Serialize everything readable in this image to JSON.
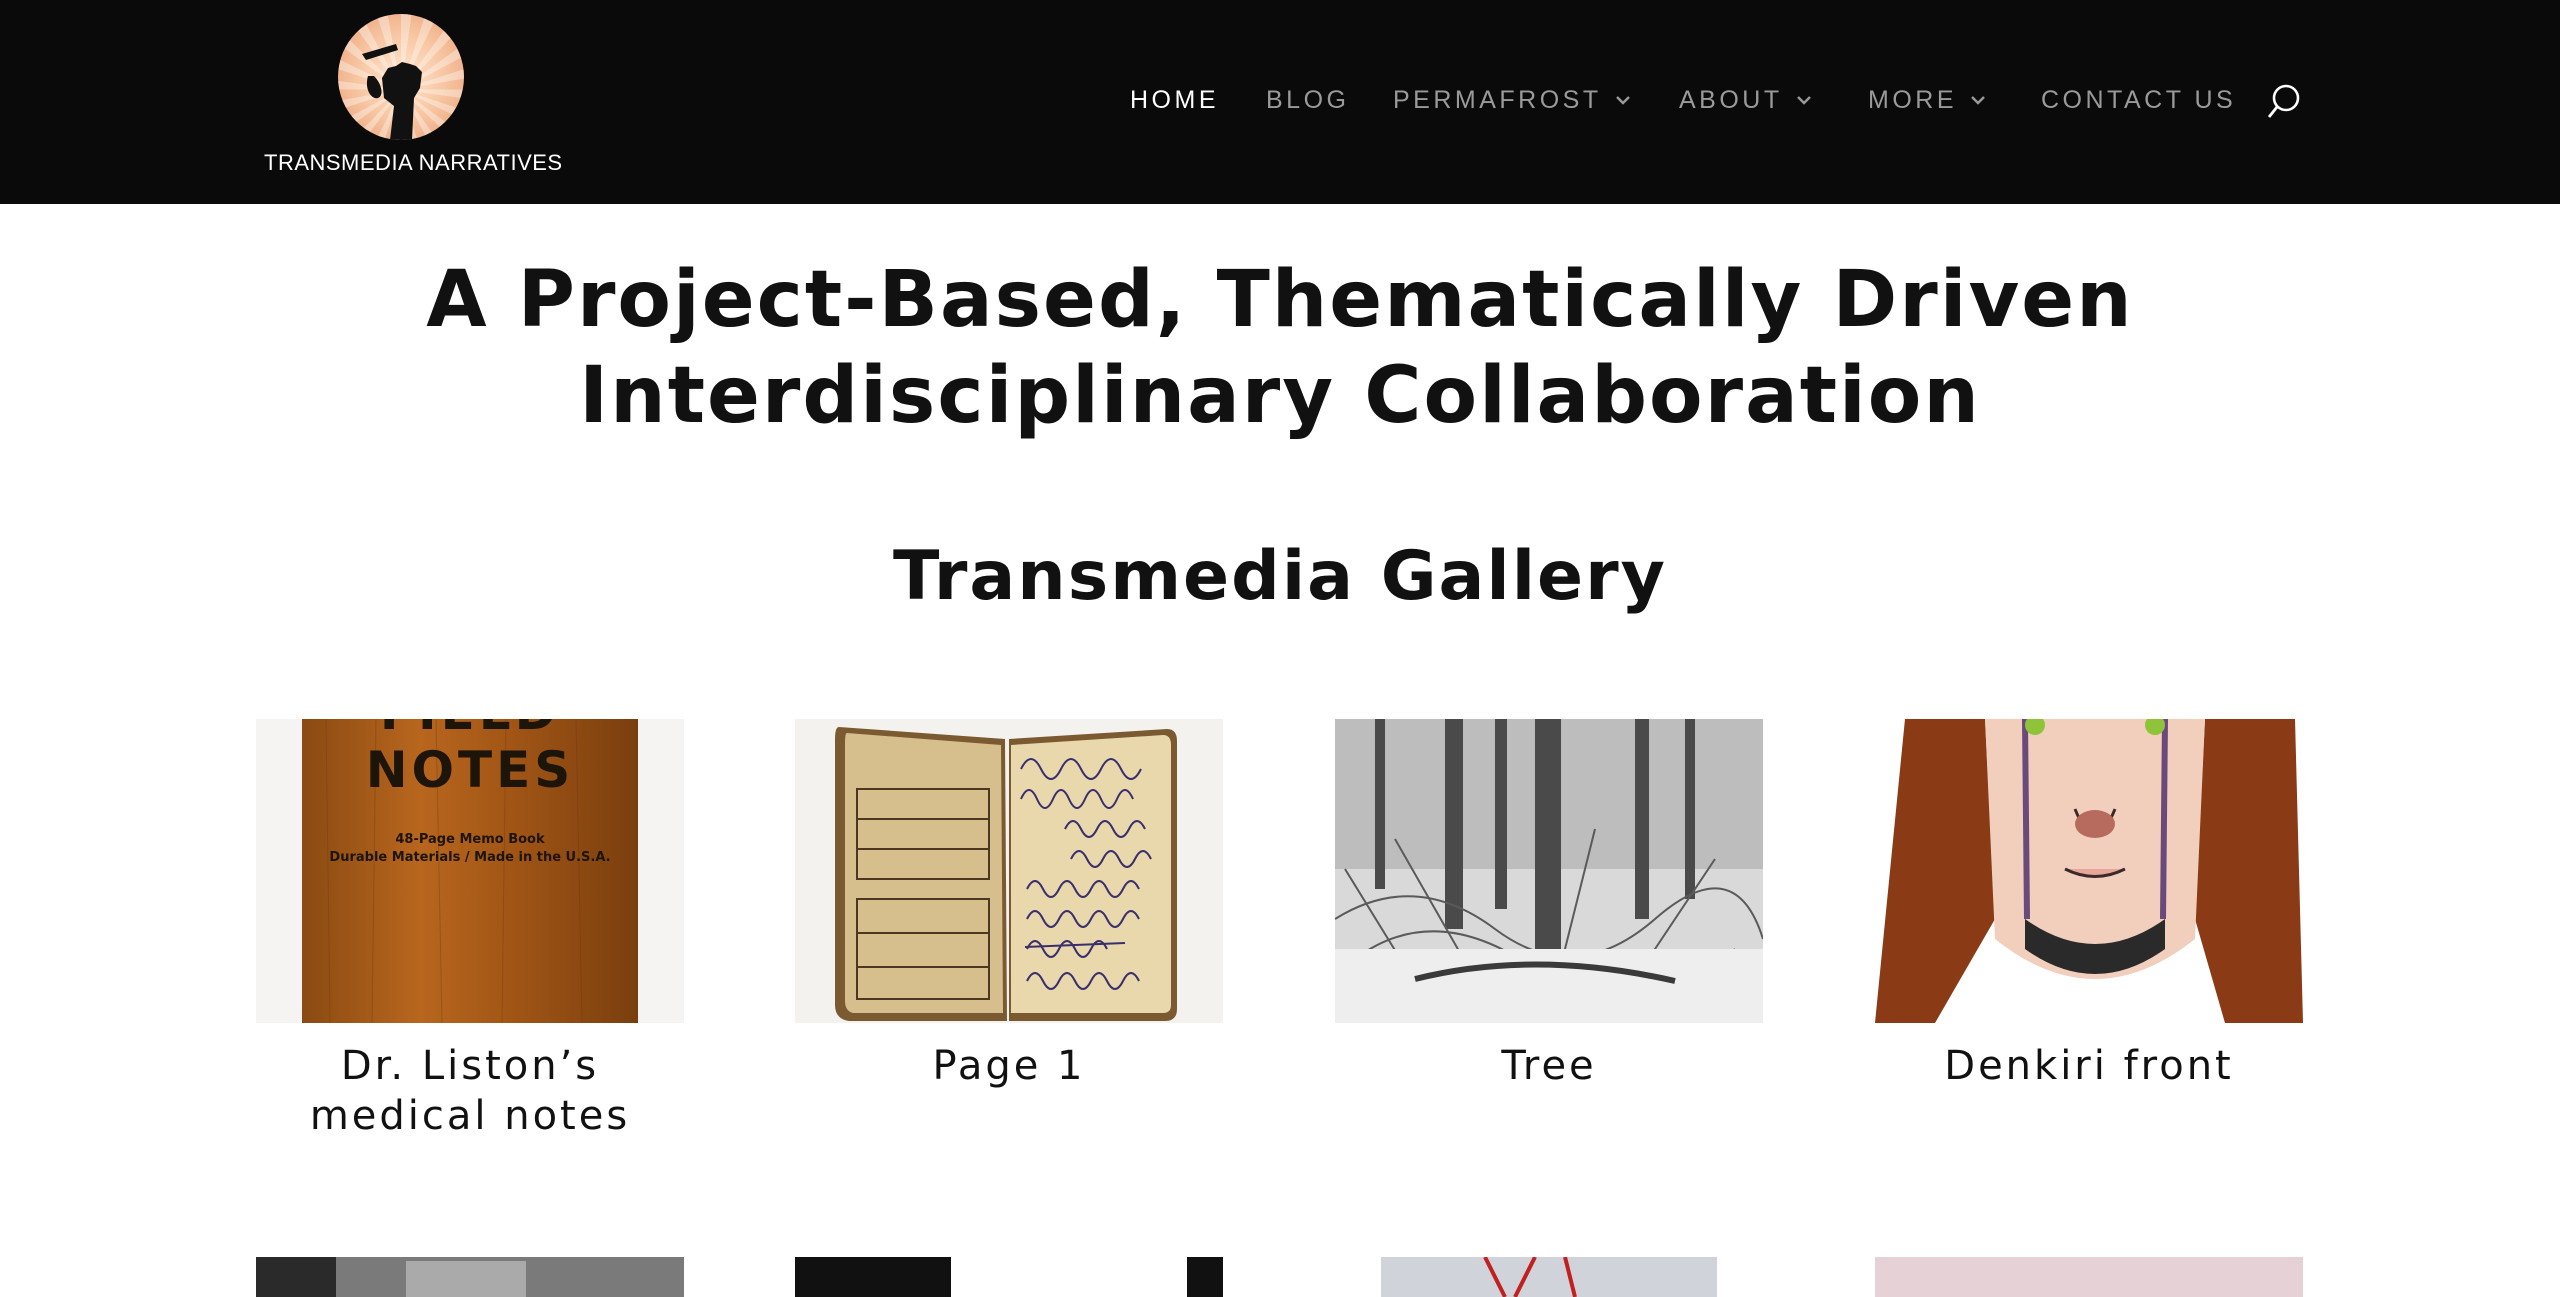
{
  "site": {
    "logo_text": "TRANSMEDIA NARRATIVES",
    "logo_icon": "raised-fist-icon"
  },
  "nav": {
    "items": [
      {
        "label": "HOME",
        "active": true,
        "has_dropdown": false
      },
      {
        "label": "BLOG",
        "active": false,
        "has_dropdown": false
      },
      {
        "label": "PERMAFROST",
        "active": false,
        "has_dropdown": true
      },
      {
        "label": "ABOUT",
        "active": false,
        "has_dropdown": true
      },
      {
        "label": "MORE",
        "active": false,
        "has_dropdown": true
      },
      {
        "label": "CONTACT US",
        "active": false,
        "has_dropdown": false
      }
    ],
    "search_icon": "search-icon"
  },
  "main": {
    "hero_line1": "A Project-Based, Thematically Driven",
    "hero_line2": "Interdisciplinary Collaboration",
    "gallery_title": "Transmedia Gallery",
    "gallery": [
      {
        "caption_line1": "Dr. Liston’s",
        "caption_line2": "medical notes"
      },
      {
        "caption_line1": "Page 1",
        "caption_line2": ""
      },
      {
        "caption_line1": "Tree",
        "caption_line2": ""
      },
      {
        "caption_line1": "Denkiri front",
        "caption_line2": ""
      }
    ],
    "notebook_cover": {
      "brand": "FIELD",
      "line": "NOTES",
      "sub1": "48-Page Memo Book",
      "sub2": "Durable Materials / Made in the U.S.A."
    }
  },
  "colors": {
    "header_bg": "#0a0a0a",
    "nav_active": "#ffffff",
    "nav_inactive": "#9a9a9a",
    "heading": "#111111"
  }
}
